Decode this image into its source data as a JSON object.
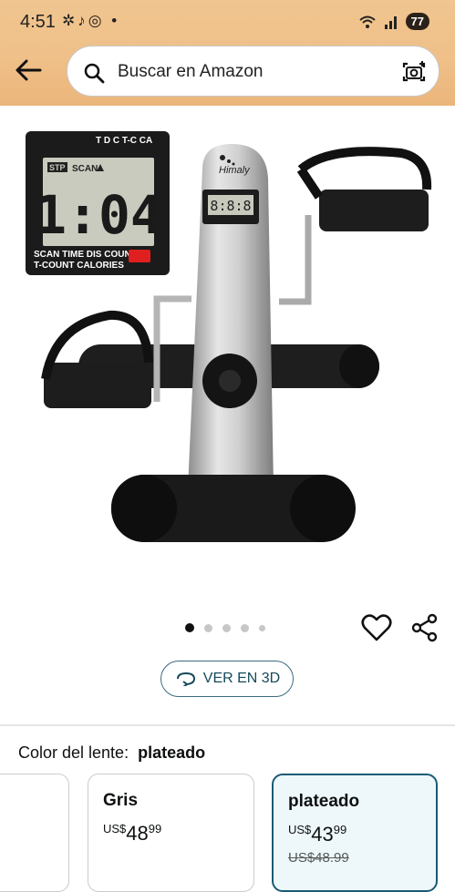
{
  "status_bar": {
    "time": "4:51",
    "battery": "77"
  },
  "search": {
    "placeholder": "Buscar en Amazon"
  },
  "product_image": {
    "brand": "Himaly",
    "display_value": "1:04",
    "display_labels": {
      "top": "T D C T-C CA",
      "stp": "STP",
      "scan": "SCAN"
    },
    "display_caption_1": "SCAN TIME DIS COUNT",
    "display_caption_2": "T-COUNT CALORIES"
  },
  "carousel": {
    "dots": 5,
    "active_index": 0
  },
  "view_3d_label": "VER EN 3D",
  "color": {
    "label": "Color del lente:",
    "selected": "plateado"
  },
  "options": [
    {
      "name": "Gris",
      "currency": "US$",
      "price_whole": "48",
      "price_fraction": "99"
    },
    {
      "name": "plateado",
      "currency": "US$",
      "price_whole": "43",
      "price_fraction": "99",
      "was": "US$48.99"
    }
  ]
}
